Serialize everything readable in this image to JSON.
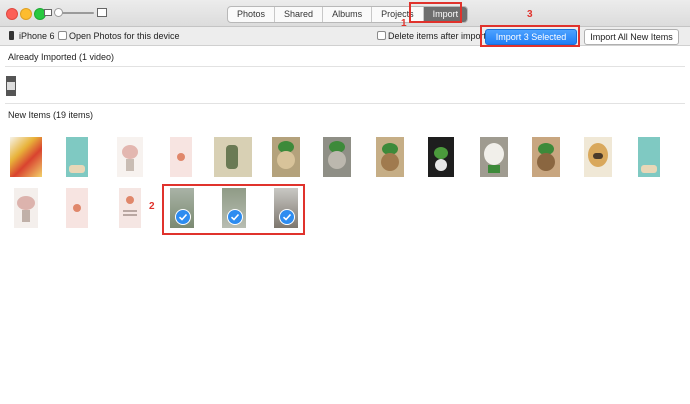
{
  "toolbar": {
    "tabs": [
      {
        "label": "Photos"
      },
      {
        "label": "Shared"
      },
      {
        "label": "Albums"
      },
      {
        "label": "Projects"
      },
      {
        "label": "Import"
      }
    ]
  },
  "import_bar": {
    "device": "iPhone 6",
    "open_photos_label": "Open Photos for this device",
    "delete_after_label": "Delete items after import",
    "import_selected_label": "Import 3 Selected",
    "import_all_label": "Import All New Items"
  },
  "sections": {
    "already_imported": "Already Imported (1 video)",
    "new_items": "New Items (19 items)"
  },
  "annotations": {
    "step1": "1",
    "step2": "2",
    "step3": "3"
  },
  "icons": {
    "close": "close-traffic-light",
    "minimize": "minimize-traffic-light",
    "zoom": "zoom-traffic-light",
    "thumbnail_small": "small-photo-icon",
    "thumbnail_large": "large-photo-icon",
    "device": "iphone-icon",
    "selected": "checkmark-icon"
  },
  "colors": {
    "accent": "#2d8cf0",
    "annotation": "#e0322c",
    "active_tab": "#6e6e6e"
  },
  "thumbnails": {
    "row1": [
      {
        "subject": "yellow flowers",
        "color": "#e8b33a"
      },
      {
        "subject": "teal cartoon",
        "color": "#7fc9c2"
      },
      {
        "subject": "pink flowers vase",
        "color": "#e9d2cf"
      },
      {
        "subject": "pink card",
        "color": "#f3dcd8"
      },
      {
        "subject": "cactus drawing",
        "color": "#d8d0b4"
      },
      {
        "subject": "dog with frog hat",
        "color": "#8a7a52"
      },
      {
        "subject": "cat with frog hat",
        "color": "#9d9a88"
      },
      {
        "subject": "dog with frog hat",
        "color": "#a88a62"
      },
      {
        "subject": "frog hat dark",
        "color": "#3c4a32"
      },
      {
        "subject": "white dog",
        "color": "#b9b4a8"
      },
      {
        "subject": "dog with frog hat",
        "color": "#a07a4e"
      },
      {
        "subject": "golden dog",
        "color": "#d9b87c"
      },
      {
        "subject": "teal cartoon",
        "color": "#7fc9c2"
      }
    ],
    "row2": [
      {
        "subject": "pink flowers vase",
        "color": "#e4cfc8"
      },
      {
        "subject": "pink card",
        "color": "#f3dcd8"
      },
      {
        "subject": "pink card text",
        "color": "#efdcd8",
        "selected": false
      },
      {
        "subject": "street scene",
        "color": "#8d9a88",
        "selected": true
      },
      {
        "subject": "trees sky",
        "color": "#9aa595",
        "selected": true
      },
      {
        "subject": "mountain road",
        "color": "#8d8a84",
        "selected": true
      }
    ]
  }
}
